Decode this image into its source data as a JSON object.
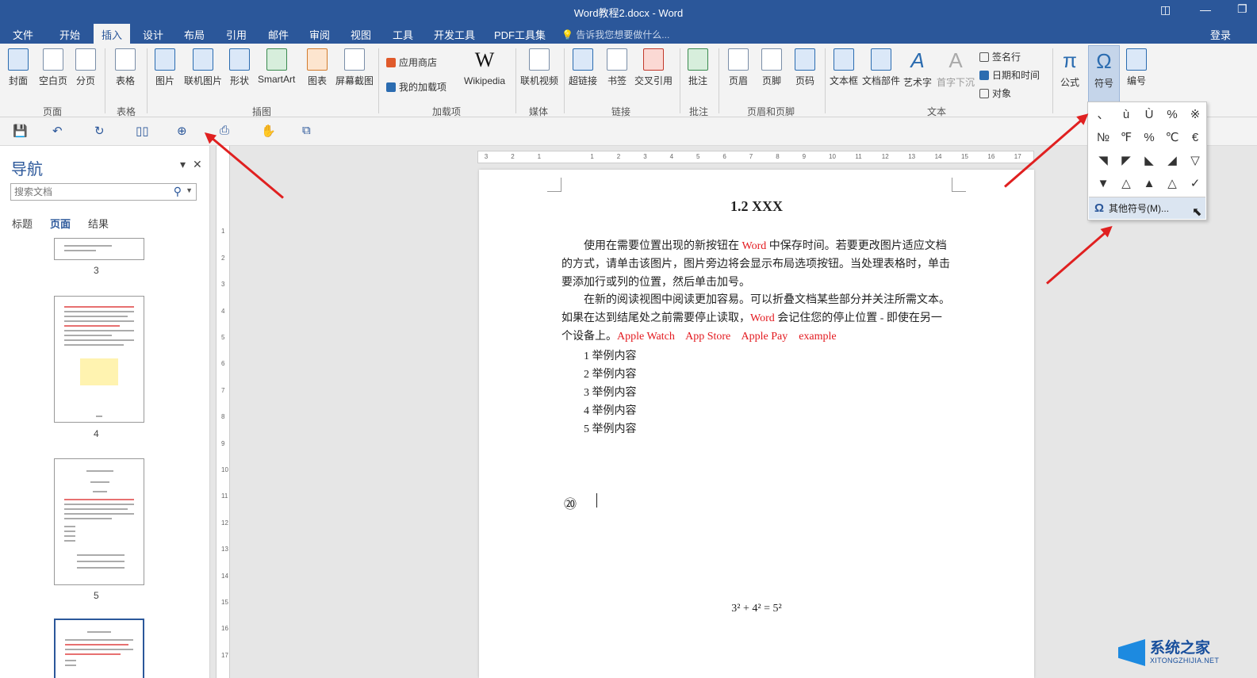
{
  "titlebar": {
    "title": "Word教程2.docx - Word"
  },
  "menu": {
    "items": [
      "文件",
      "开始",
      "插入",
      "设计",
      "布局",
      "引用",
      "邮件",
      "审阅",
      "视图",
      "工具",
      "开发工具",
      "PDF工具集"
    ],
    "tell": "告诉我您想要做什么...",
    "login": "登录"
  },
  "ribbon": {
    "pages": [
      "封面",
      "空白页",
      "分页"
    ],
    "table": "表格",
    "illus": [
      "图片",
      "联机图片",
      "形状",
      "SmartArt",
      "图表",
      "屏幕截图"
    ],
    "addins": {
      "store": "应用商店",
      "my": "我的加载项",
      "wiki": "Wikipedia"
    },
    "media": "联机视频",
    "links": [
      "超链接",
      "书签",
      "交叉引用"
    ],
    "comment": "批注",
    "hf": [
      "页眉",
      "页脚",
      "页码"
    ],
    "text": [
      "文本框",
      "文档部件",
      "艺术字",
      "首字下沉"
    ],
    "textsmall": [
      "签名行",
      "日期和时间",
      "对象"
    ],
    "symbols": [
      "公式",
      "符号",
      "编号"
    ],
    "groups": [
      "页面",
      "表格",
      "插图",
      "加载项",
      "媒体",
      "链接",
      "批注",
      "页眉和页脚",
      "文本"
    ]
  },
  "nav": {
    "title": "导航",
    "search_placeholder": "搜索文档",
    "tabs": [
      "标题",
      "页面",
      "结果"
    ],
    "pages": [
      "3",
      "4",
      "5"
    ]
  },
  "doc": {
    "heading": "1.2 XXX",
    "p1": {
      "a": "使用在需要位置出现的新按钮在 ",
      "b": "Word",
      "c": " 中保存时间。若要更改图片适应文档的方式，请单击该图片，图片旁边将会显示布局选项按钮。当处理表格时，单击要添加行或列的位置，然后单击加号。"
    },
    "p2": {
      "a": "在新的阅读视图中阅读更加容易。可以折叠文档某些部分并关注所需文本。如果在达到结尾处之前需要停止读取，",
      "b": "Word",
      "c": " 会记住您的停止位置 - 即使在另一个设备上。",
      "d": "Apple Watch    App Store    Apple Pay    example"
    },
    "list": [
      "1 举例内容",
      "2 举例内容",
      "3 举例内容",
      "4 举例内容",
      "5 举例内容"
    ],
    "circled": "⑳",
    "equation": "3² + 4² = 5²"
  },
  "symbols_dropdown": {
    "items": [
      "、",
      "ù",
      "Ù",
      "%",
      "※",
      "№",
      "℉",
      "%",
      "℃",
      "€",
      "◥",
      "◤",
      "◣",
      "◢",
      "▽",
      "▼",
      "△",
      "▲",
      "△",
      "✓"
    ],
    "more": "其他符号(M)..."
  },
  "watermark": {
    "name": "系统之家",
    "url": "XITONGZHIJIA.NET"
  }
}
